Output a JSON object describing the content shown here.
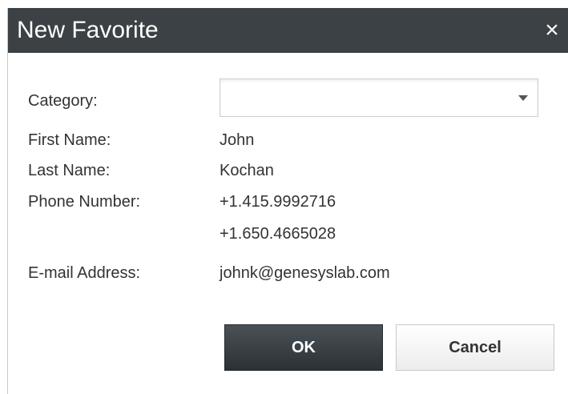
{
  "dialog": {
    "title": "New Favorite",
    "close_symbol": "×"
  },
  "form": {
    "category_label": "Category:",
    "category_value": "",
    "first_name_label": "First Name:",
    "first_name_value": "John",
    "last_name_label": "Last Name:",
    "last_name_value": "Kochan",
    "phone_label": "Phone Number:",
    "phones": [
      "+1.415.9992716",
      "+1.650.4665028"
    ],
    "email_label": "E-mail Address:",
    "email_value": "johnk@genesyslab.com"
  },
  "buttons": {
    "ok_label": "OK",
    "cancel_label": "Cancel"
  },
  "colors": {
    "titlebar": "#3b4145",
    "ok_button": "#2b3135"
  },
  "icons": {
    "close": "close-icon",
    "dropdown": "chevron-down-icon"
  }
}
